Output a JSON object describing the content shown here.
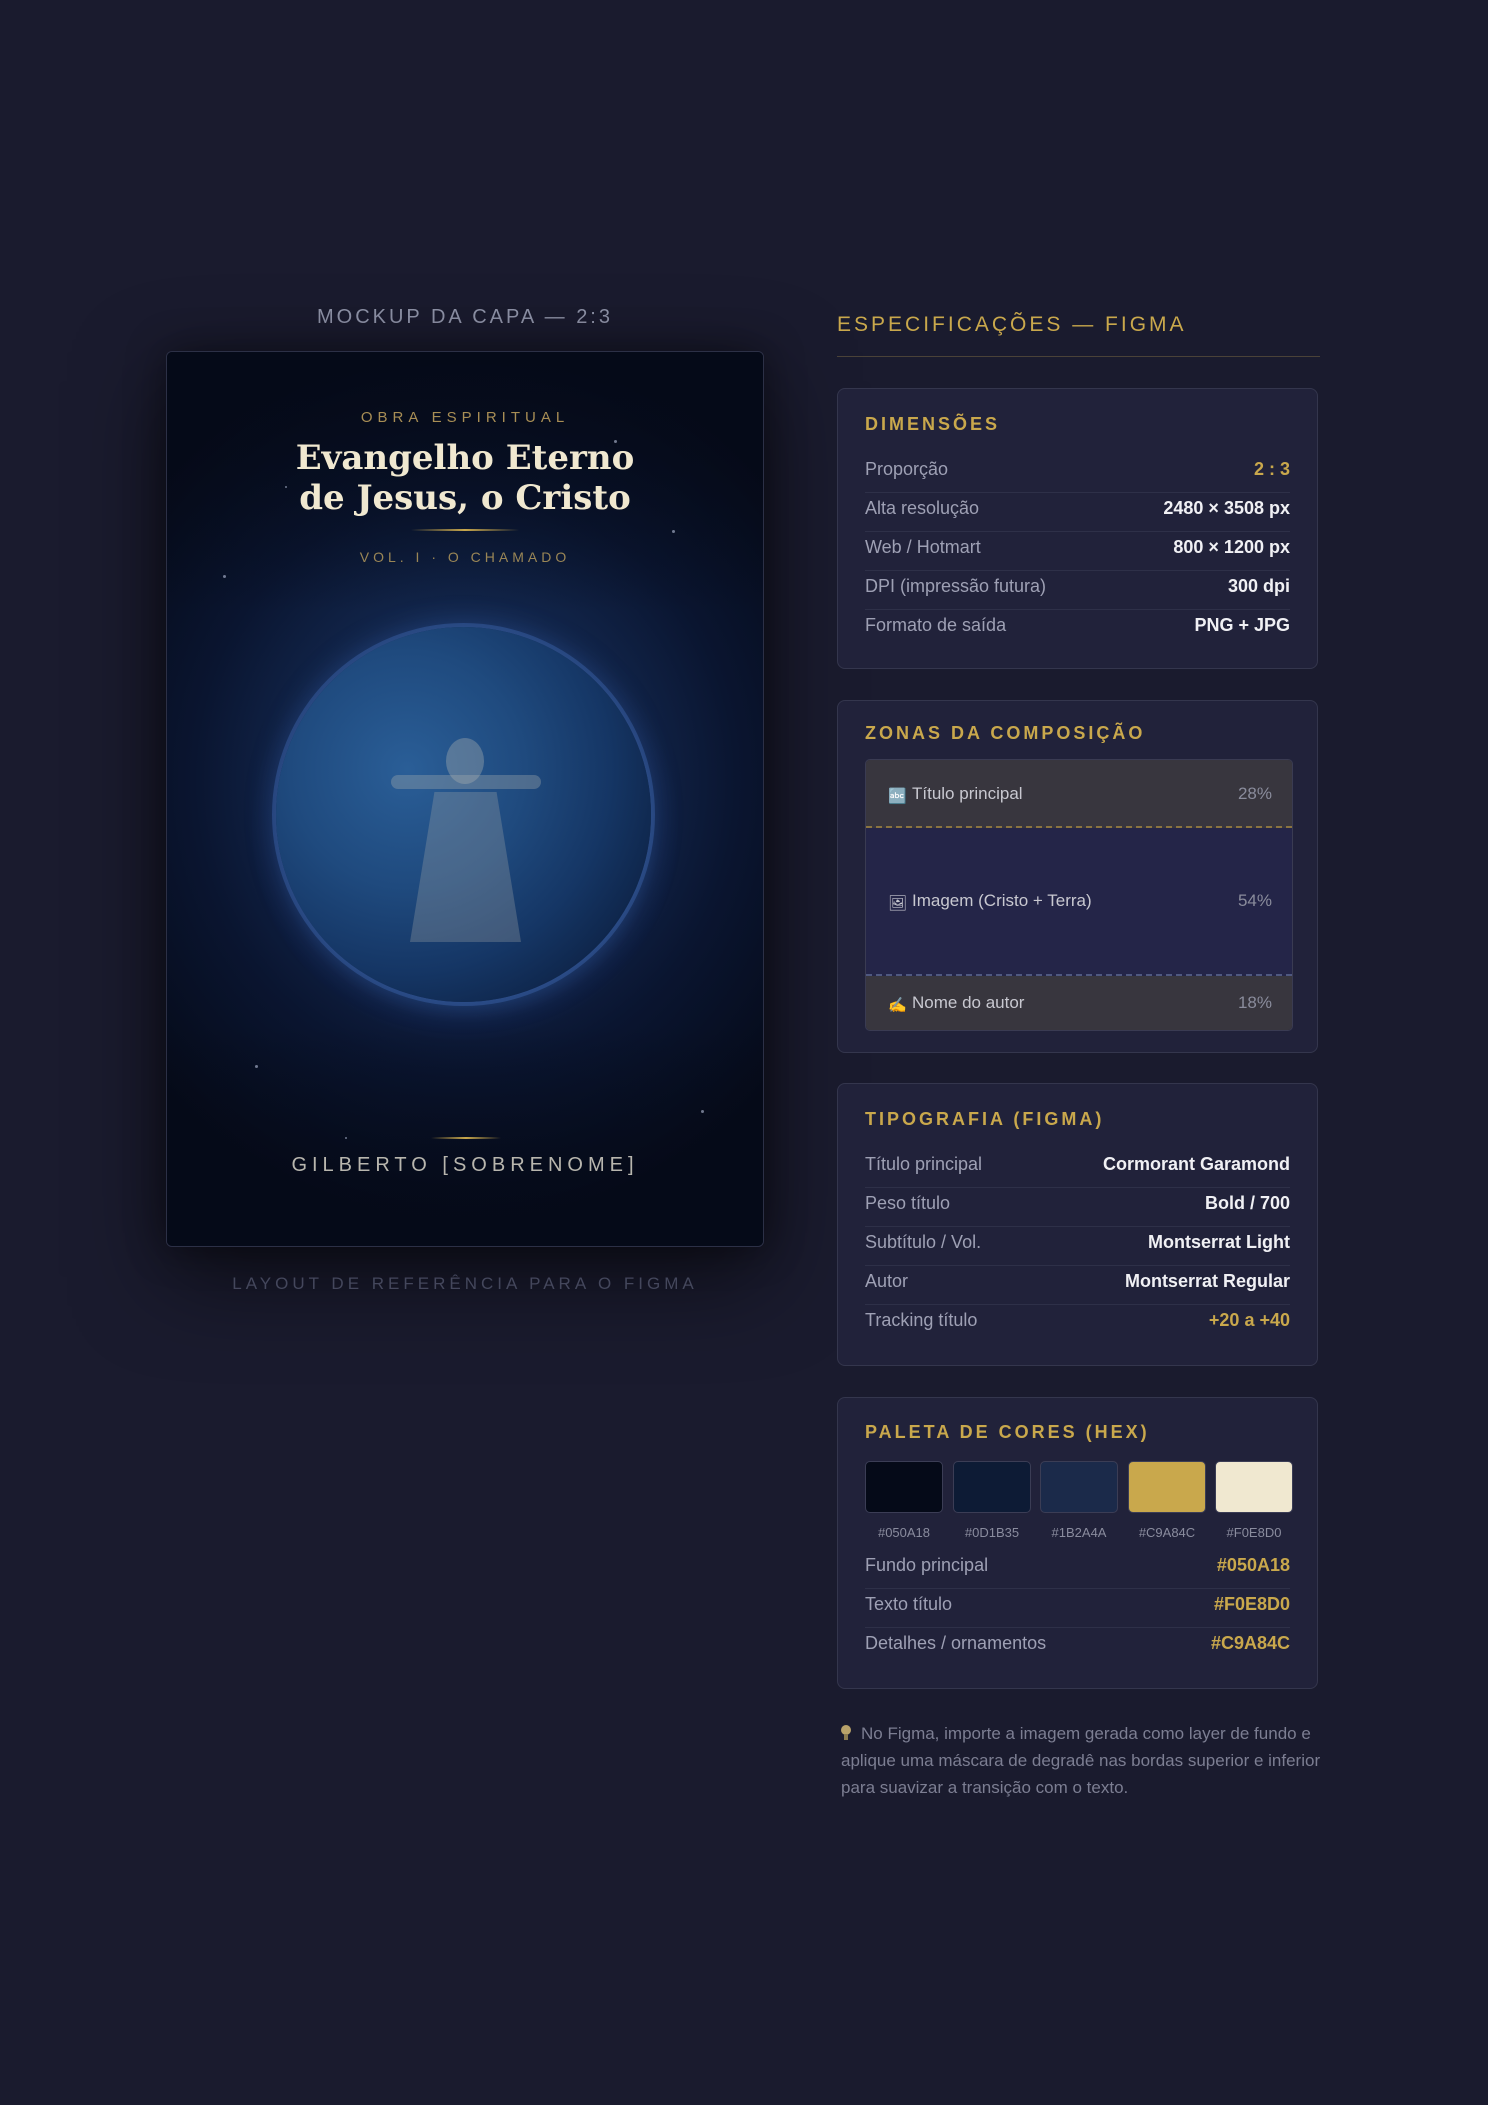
{
  "mockup": {
    "label": "MOCKUP DA CAPA — 2:3",
    "footer": "LAYOUT DE REFERÊNCIA PARA O FIGMA",
    "cover": {
      "kicker": "OBRA ESPIRITUAL",
      "title_line1": "Evangelho Eterno",
      "title_line2": "de Jesus, o Cristo",
      "volume": "VOL. I  ·  O CHAMADO",
      "author": "GILBERTO [SOBRENOME]"
    }
  },
  "specs": {
    "title": "ESPECIFICAÇÕES — FIGMA",
    "dimensions": {
      "heading": "DIMENSÕES",
      "rows": [
        {
          "label": "Proporção",
          "value": "2 : 3",
          "accent": true
        },
        {
          "label": "Alta resolução",
          "value": "2480 × 3508 px"
        },
        {
          "label": "Web / Hotmart",
          "value": "800 × 1200 px"
        },
        {
          "label": "DPI (impressão futura)",
          "value": "300 dpi"
        },
        {
          "label": "Formato de saída",
          "value": "PNG + JPG"
        }
      ]
    },
    "zones": {
      "heading": "ZONAS DA COMPOSIÇÃO",
      "items": [
        {
          "icon": "text-abc-icon",
          "label": "Título principal",
          "percent": "28%",
          "share": 28
        },
        {
          "icon": "picture-frame-icon",
          "label": "Imagem (Cristo + Terra)",
          "percent": "54%",
          "share": 54
        },
        {
          "icon": "writing-hand-icon",
          "label": "Nome do autor",
          "percent": "18%",
          "share": 18
        }
      ]
    },
    "typography": {
      "heading": "TIPOGRAFIA (FIGMA)",
      "rows": [
        {
          "label": "Título principal",
          "value": "Cormorant Garamond"
        },
        {
          "label": "Peso título",
          "value": "Bold / 700"
        },
        {
          "label": "Subtítulo / Vol.",
          "value": "Montserrat Light"
        },
        {
          "label": "Autor",
          "value": "Montserrat Regular"
        },
        {
          "label": "Tracking título",
          "value": "+20 a +40",
          "accent": true
        }
      ]
    },
    "palette": {
      "heading": "PALETA DE CORES (HEX)",
      "swatches": [
        {
          "hex": "#050A18",
          "label": "#050A18"
        },
        {
          "hex": "#0D1B35",
          "label": "#0D1B35"
        },
        {
          "hex": "#1B2A4A",
          "label": "#1B2A4A"
        },
        {
          "hex": "#C9A84C",
          "label": "#C9A84C"
        },
        {
          "hex": "#F0E8D0",
          "label": "#F0E8D0"
        }
      ],
      "rows": [
        {
          "label": "Fundo principal",
          "value": "#050A18"
        },
        {
          "label": "Texto título",
          "value": "#F0E8D0"
        },
        {
          "label": "Detalhes / ornamentos",
          "value": "#C9A84C"
        }
      ]
    },
    "tip": {
      "icon": "lightbulb-icon",
      "text": "No Figma, importe a imagem gerada como layer de fundo e aplique uma máscara de degradê nas bordas superior e inferior para suavizar a transição com o texto."
    }
  },
  "colors": {
    "background": "#1a1b2e",
    "accent": "#c9a84c",
    "card": "#21223a"
  }
}
